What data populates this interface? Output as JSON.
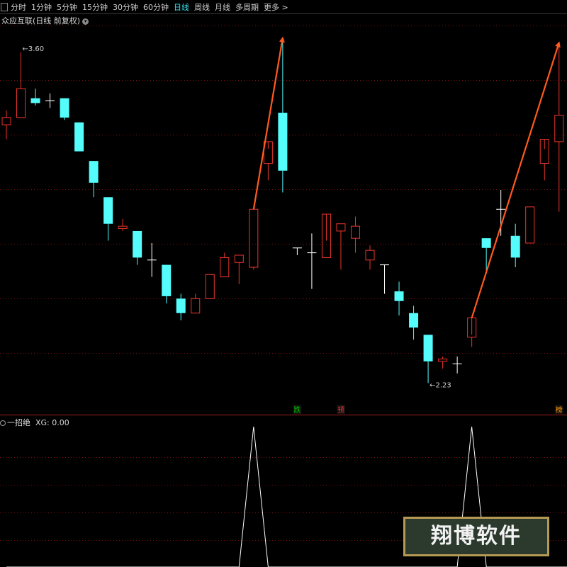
{
  "toolbar": {
    "tabs": [
      "分时",
      "1分钟",
      "5分钟",
      "15分钟",
      "30分钟",
      "60分钟",
      "日线",
      "周线",
      "月线",
      "多周期",
      "更多 >"
    ],
    "active": "日线"
  },
  "header": {
    "title": "众应互联(日线 前复权)"
  },
  "indicator": {
    "title": "一招绝",
    "readout": "XG: 0.00"
  },
  "watermark": "翔博软件",
  "colors": {
    "up": "#e8352c",
    "down": "#54fcfc",
    "doji": "#ffffff",
    "arrow": "#ff5a1e",
    "grid": "#7a1010",
    "xg_line": "#ffffff"
  },
  "chart_data": [
    {
      "type": "candlestick",
      "ylim": [
        2.12,
        3.72
      ],
      "candles": [
        {
          "o": 3.3,
          "h": 3.36,
          "l": 3.24,
          "c": 3.33
        },
        {
          "o": 3.33,
          "h": 3.6,
          "l": 3.33,
          "c": 3.45
        },
        {
          "o": 3.41,
          "h": 3.45,
          "l": 3.38,
          "c": 3.39
        },
        {
          "o": 3.4,
          "h": 3.43,
          "l": 3.37,
          "c": 3.4
        },
        {
          "o": 3.41,
          "h": 3.41,
          "l": 3.32,
          "c": 3.33
        },
        {
          "o": 3.31,
          "h": 3.31,
          "l": 3.19,
          "c": 3.19
        },
        {
          "o": 3.15,
          "h": 3.15,
          "l": 3.0,
          "c": 3.06
        },
        {
          "o": 3.0,
          "h": 3.0,
          "l": 2.82,
          "c": 2.89
        },
        {
          "o": 2.87,
          "h": 2.91,
          "l": 2.86,
          "c": 2.88
        },
        {
          "o": 2.86,
          "h": 2.86,
          "l": 2.72,
          "c": 2.75
        },
        {
          "o": 2.74,
          "h": 2.81,
          "l": 2.67,
          "c": 2.74
        },
        {
          "o": 2.72,
          "h": 2.72,
          "l": 2.56,
          "c": 2.59
        },
        {
          "o": 2.58,
          "h": 2.6,
          "l": 2.49,
          "c": 2.52
        },
        {
          "o": 2.52,
          "h": 2.6,
          "l": 2.52,
          "c": 2.58
        },
        {
          "o": 2.58,
          "h": 2.68,
          "l": 2.58,
          "c": 2.68
        },
        {
          "o": 2.67,
          "h": 2.77,
          "l": 2.67,
          "c": 2.75
        },
        {
          "o": 2.73,
          "h": 2.76,
          "l": 2.64,
          "c": 2.76
        },
        {
          "o": 2.71,
          "h": 2.95,
          "l": 2.7,
          "c": 2.95
        },
        {
          "o": 3.14,
          "h": 3.2,
          "l": 3.07,
          "c": 3.23
        },
        {
          "o": 3.35,
          "h": 3.65,
          "l": 3.02,
          "c": 3.11
        },
        {
          "o": 2.79,
          "h": 2.79,
          "l": 2.76,
          "c": 2.79
        },
        {
          "o": 2.77,
          "h": 2.85,
          "l": 2.62,
          "c": 2.77
        },
        {
          "o": 2.75,
          "h": 2.82,
          "l": 2.75,
          "c": 2.93
        },
        {
          "o": 2.86,
          "h": 2.89,
          "l": 2.7,
          "c": 2.89
        },
        {
          "o": 2.83,
          "h": 2.92,
          "l": 2.77,
          "c": 2.88
        },
        {
          "o": 2.74,
          "h": 2.8,
          "l": 2.7,
          "c": 2.78
        },
        {
          "o": 2.72,
          "h": 2.72,
          "l": 2.6,
          "c": 2.72
        },
        {
          "o": 2.61,
          "h": 2.65,
          "l": 2.51,
          "c": 2.57
        },
        {
          "o": 2.52,
          "h": 2.55,
          "l": 2.41,
          "c": 2.46
        },
        {
          "o": 2.43,
          "h": 2.43,
          "l": 2.23,
          "c": 2.32
        },
        {
          "o": 2.32,
          "h": 2.34,
          "l": 2.29,
          "c": 2.33
        },
        {
          "o": 2.31,
          "h": 2.34,
          "l": 2.27,
          "c": 2.31
        },
        {
          "o": 2.42,
          "h": 2.43,
          "l": 2.38,
          "c": 2.5
        },
        {
          "o": 2.83,
          "h": 2.83,
          "l": 2.69,
          "c": 2.79
        },
        {
          "o": 2.95,
          "h": 3.03,
          "l": 2.84,
          "c": 2.95
        },
        {
          "o": 2.84,
          "h": 2.89,
          "l": 2.71,
          "c": 2.75
        },
        {
          "o": 2.81,
          "h": 2.96,
          "l": 2.81,
          "c": 2.96
        },
        {
          "o": 3.14,
          "h": 3.2,
          "l": 3.07,
          "c": 3.24
        },
        {
          "o": 3.23,
          "h": 3.63,
          "l": 2.94,
          "c": 3.34
        },
        {
          "o": 3.31,
          "h": 3.35,
          "l": 3.13,
          "c": 3.13
        }
      ],
      "annotations": [
        {
          "text": "3.60",
          "index": 1,
          "value": 3.6
        },
        {
          "text": "2.23",
          "index": 29,
          "value": 2.23
        }
      ],
      "markers": [
        {
          "text": "跌",
          "index": 20,
          "color": "#00c800"
        },
        {
          "text": "预",
          "index": 23,
          "color": "#e8352c"
        },
        {
          "text": "榜",
          "index": 38,
          "color": "#ff9a00"
        }
      ],
      "arrows": [
        {
          "from_index": 17,
          "from_value": 2.95,
          "to_index": 19,
          "to_value": 3.66
        },
        {
          "from_index": 32,
          "from_value": 2.5,
          "to_index": 38,
          "to_value": 3.64
        }
      ]
    },
    {
      "type": "line",
      "name": "XG",
      "ylim": [
        0,
        1
      ],
      "peaks_at_index": [
        17,
        32
      ],
      "values": [
        0,
        0,
        0,
        0,
        0,
        0,
        0,
        0,
        0,
        0,
        0,
        0,
        0,
        0,
        0,
        0,
        0,
        1,
        0,
        0,
        0,
        0,
        0,
        0,
        0,
        0,
        0,
        0,
        0,
        0,
        0,
        0,
        1,
        0,
        0,
        0,
        0,
        0,
        0,
        0
      ]
    }
  ]
}
